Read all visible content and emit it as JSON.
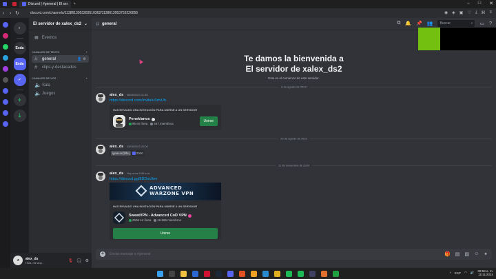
{
  "browser": {
    "tabs": [
      {
        "label": "",
        "color": "#5865f2"
      },
      {
        "label": "",
        "color": "#cc2233"
      },
      {
        "label": "Discord | #general | El ser",
        "color": "#5865f2"
      }
    ],
    "new_tab": "+",
    "url": "discord.com/channels/1138613953283510362/1138613953755226056",
    "window_buttons": [
      "–",
      "□",
      "✕"
    ]
  },
  "server": {
    "name": "El servidor de xalex_ds2",
    "events_label": "Eventos",
    "categories": [
      {
        "label": "CANALES DE TEXTO",
        "channels": [
          {
            "name": "general",
            "selected": true
          },
          {
            "name": "clips-y-destacados",
            "selected": false
          }
        ]
      },
      {
        "label": "CANALES DE VOZ",
        "channels": [
          {
            "name": "Sala",
            "selected": false
          },
          {
            "name": "Juegos",
            "selected": false
          }
        ]
      }
    ]
  },
  "rail": {
    "servers": [
      {
        "label": "Esda",
        "active": false
      },
      {
        "label": "Esda",
        "active": true
      }
    ]
  },
  "user": {
    "name": "alex_ds",
    "status": "Hola, me doy..."
  },
  "chat": {
    "channel_name": "general",
    "search_placeholder": "Buscar",
    "welcome_line1": "Te damos la bienvenida a",
    "welcome_line2": "El servidor de xalex_ds2",
    "welcome_sub": "Este es el comienzo de este servidor.",
    "dividers": [
      "8 de agosto de 2023",
      "23 de agosto de 2023",
      "11 de noviembre de 2024"
    ],
    "messages": [
      {
        "author": "alex_ds",
        "time": "08/08/2023 11:35",
        "link": "https://discord.com/invite/uSrtvUh",
        "invite": {
          "title": "HAS ENVIADO UNA INVITACIÓN PARA UNIRSE A UN SERVIDOR",
          "server": "Penekianos",
          "online": "95 en línea",
          "members": "457 miembros",
          "button": "Unirse"
        }
      },
      {
        "author": "alex_ds",
        "time": "23/08/2023 20:00",
        "pill_user": "ignacio@lhq",
        "pill_label": "0000"
      },
      {
        "author": "alex_ds",
        "time": "Hoy a las 8:09 a.m.",
        "link": "https://discord.gg/8DDuc9ee",
        "banner_text": [
          "ADVANCED",
          "WARZONE VPN"
        ],
        "invite": {
          "title": "HAS ENVIADO UNA INVITACIÓN PARA UNIRSE A UN SERVIDOR",
          "server": "SweatVPN - Advanced CoD VPN",
          "online": "2506 en línea",
          "members": "16.986 miembros",
          "button": "Unirse"
        }
      }
    ],
    "composer_placeholder": "Enviar mensaje a #general"
  },
  "tray": {
    "lang": "ESP",
    "time": "08:58 a. m.",
    "date": "11/11/2024"
  }
}
